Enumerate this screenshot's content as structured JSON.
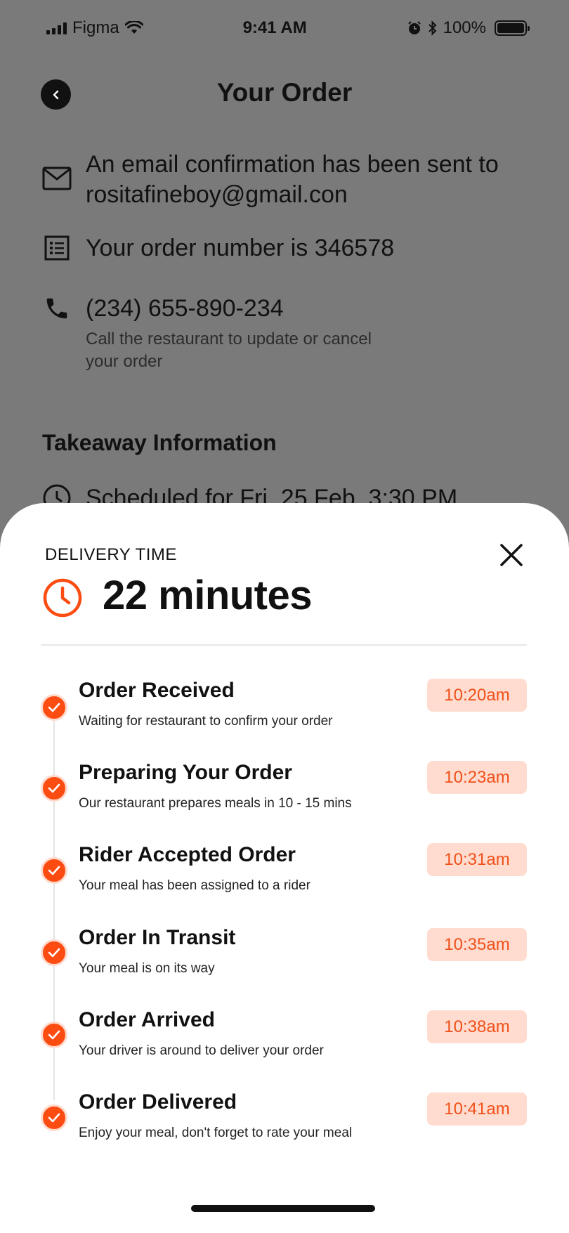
{
  "status_bar": {
    "carrier": "Figma",
    "time": "9:41 AM",
    "battery": "100%"
  },
  "header": {
    "title": "Your Order"
  },
  "info": {
    "email_line1": "An email confirmation has been sent to",
    "email_line2": "rositafineboy@gmail.con",
    "order_number": "Your order number is 346578",
    "phone": "(234) 655-890-234",
    "phone_sub_line1": "Call the restaurant to update or cancel",
    "phone_sub_line2": "your order"
  },
  "takeaway": {
    "title": "Takeaway Information",
    "schedule": "Scheduled for Fri, 25 Feb, 3:30 PM"
  },
  "sheet": {
    "label": "DELIVERY TIME",
    "time": "22 minutes",
    "accent_color": "#FC4C12",
    "badge_bg": "#FFDCCF",
    "steps": [
      {
        "title": "Order Received",
        "desc": "Waiting for restaurant to confirm your order",
        "time": "10:20am"
      },
      {
        "title": "Preparing Your Order",
        "desc": "Our restaurant prepares meals in 10 - 15 mins",
        "time": "10:23am"
      },
      {
        "title": "Rider Accepted Order",
        "desc": "Your meal has been assigned to a rider",
        "time": "10:31am"
      },
      {
        "title": "Order In Transit",
        "desc": "Your meal is on its way",
        "time": "10:35am"
      },
      {
        "title": "Order Arrived",
        "desc": "Your driver is around to deliver your order",
        "time": "10:38am"
      },
      {
        "title": "Order Delivered",
        "desc": "Enjoy your meal, don't forget to rate your meal",
        "time": "10:41am"
      }
    ]
  }
}
